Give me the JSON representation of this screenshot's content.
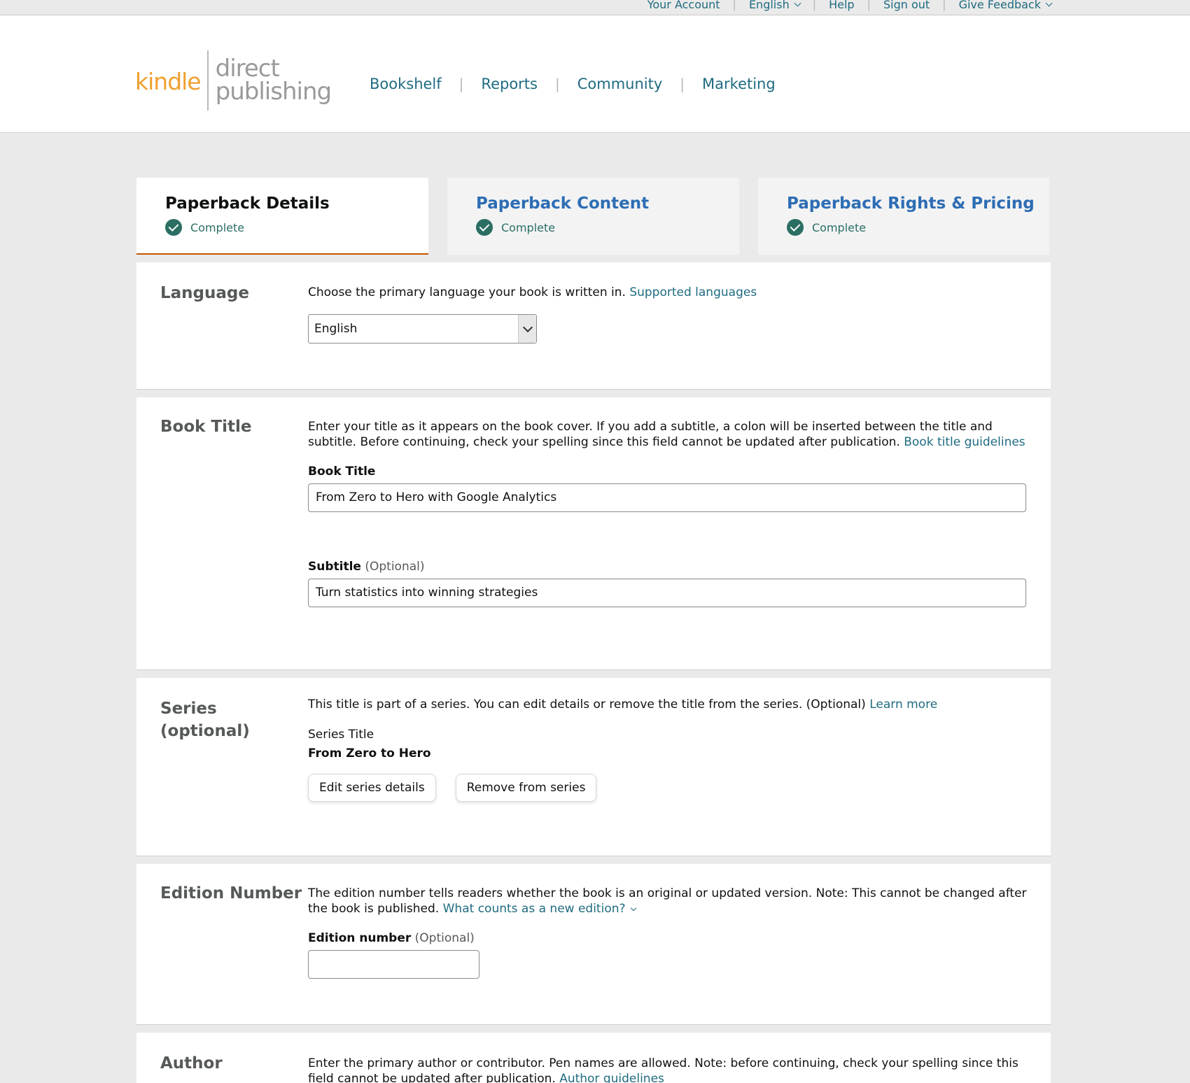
{
  "topbar": {
    "links": [
      "Your Account",
      "English",
      "Help",
      "Sign out",
      "Give Feedback"
    ]
  },
  "logo": {
    "kindle": "kindle",
    "line1": "direct",
    "line2": "publishing"
  },
  "nav": [
    "Bookshelf",
    "Reports",
    "Community",
    "Marketing"
  ],
  "tabs": [
    {
      "title": "Paperback Details",
      "status": "Complete"
    },
    {
      "title": "Paperback Content",
      "status": "Complete"
    },
    {
      "title": "Paperback Rights & Pricing",
      "status": "Complete"
    }
  ],
  "language": {
    "label": "Language",
    "description": "Choose the primary language your book is written in.",
    "link": "Supported languages",
    "selected": "English"
  },
  "book_title": {
    "label": "Book Title",
    "description": "Enter your title as it appears on the book cover. If you add a subtitle, a colon will be inserted between the title and subtitle. Before continuing, check your spelling since this field cannot be updated after publication.",
    "link": "Book title guidelines",
    "title_label": "Book Title",
    "title_value": "From Zero to Hero with Google Analytics",
    "subtitle_label": "Subtitle",
    "subtitle_optional": "(Optional)",
    "subtitle_value": "Turn statistics into winning strategies"
  },
  "series": {
    "label": "Series (optional)",
    "description": "This title is part of a series. You can edit details or remove the title from the series. (Optional)",
    "link": "Learn more",
    "series_title_label": "Series Title",
    "series_title_value": "From Zero to Hero",
    "edit_button": "Edit series details",
    "remove_button": "Remove from series"
  },
  "edition": {
    "label": "Edition Number",
    "description": "The edition number tells readers whether the book is an original or updated version. Note: This cannot be changed after the book is published.",
    "link": "What counts as a new edition?",
    "field_label": "Edition number",
    "field_optional": "(Optional)",
    "value": ""
  },
  "author": {
    "label": "Author",
    "description": "Enter the primary author or contributor. Pen names are allowed. Note: before continuing, check your spelling since this field cannot be updated after publication.",
    "link": "Author guidelines"
  },
  "colors": {
    "link": "#1f6b81",
    "tab_link": "#2d6db4",
    "active_tab_underline": "#c45500",
    "complete_green": "#2b6e62",
    "kindle_orange": "#f0a030"
  }
}
